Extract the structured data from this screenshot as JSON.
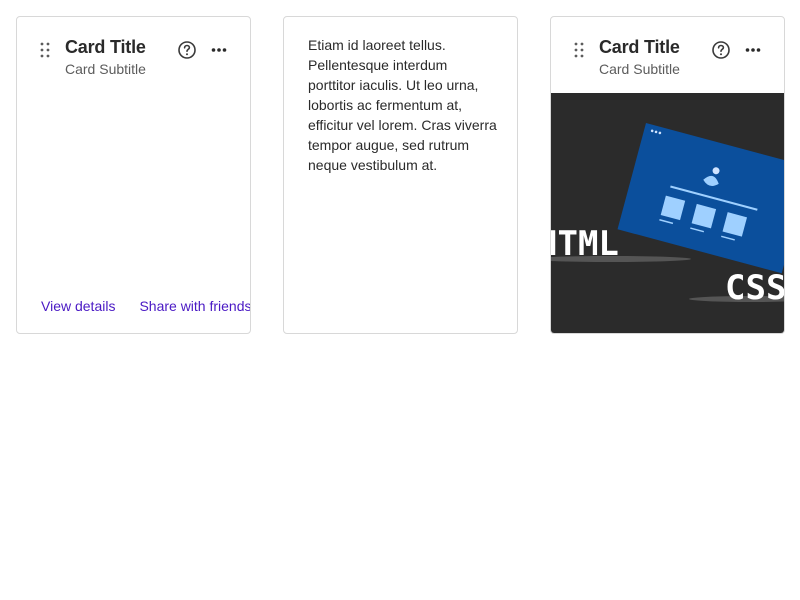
{
  "cards": [
    {
      "title": "Card Title",
      "subtitle": "Card Subtitle",
      "actions": [
        "View details",
        "Share with friends"
      ]
    },
    {
      "body": "Etiam id laoreet tellus. Pellentesque interdum porttitor iaculis. Ut leo urna, lobortis ac fermentum at, efficitur vel lorem. Cras viverra tempor augue, sed rutrum neque vestibulum at."
    },
    {
      "title": "Card Title",
      "subtitle": "Card Subtitle",
      "media": {
        "label_html": "HTML",
        "label_css": "CSS"
      }
    }
  ],
  "colors": {
    "link": "#4a19c4",
    "border": "#d8d8d8",
    "media_bg": "#2b2b2b",
    "media_accent": "#0b4f9c"
  },
  "icons": {
    "drag": "drag-handle-icon",
    "help": "help-circle-icon",
    "more": "more-horizontal-icon"
  }
}
